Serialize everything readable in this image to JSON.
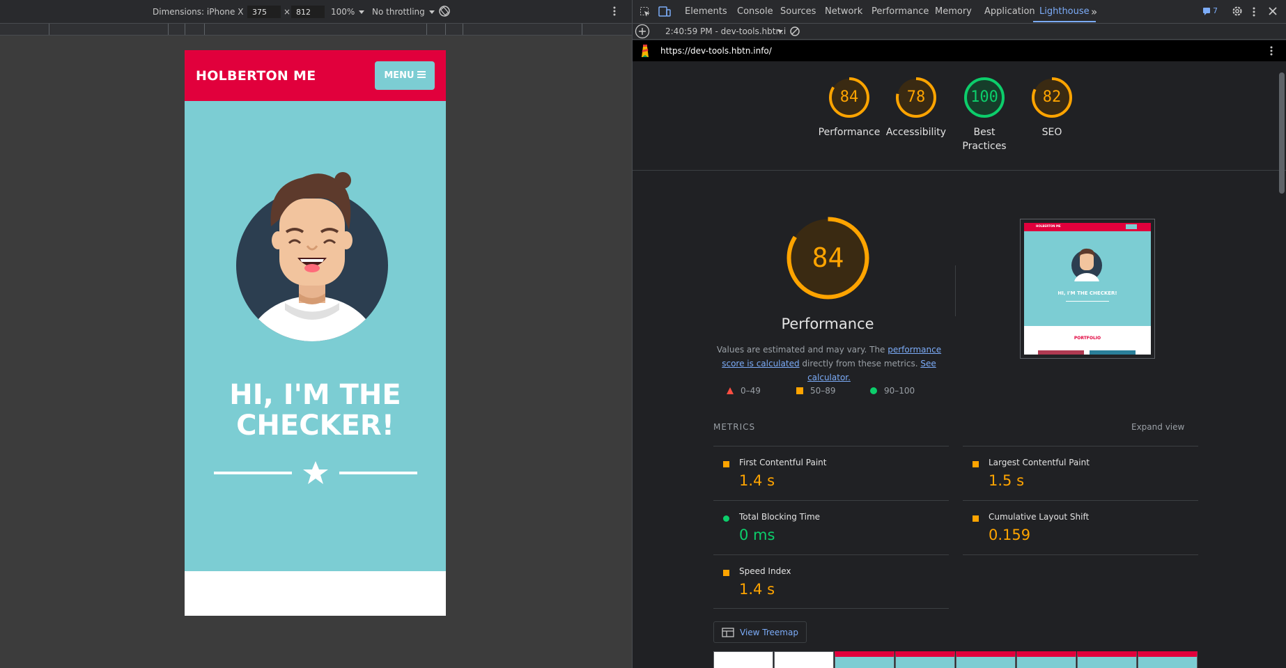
{
  "device_toolbar": {
    "dimensions_label": "Dimensions: iPhone X",
    "width": "375",
    "times": "×",
    "height": "812",
    "zoom": "100%",
    "throttling": "No throttling"
  },
  "phone": {
    "brand": "HOLBERTON ME",
    "menu_label": "MENU",
    "hero_title_line1": "HI, I'M THE",
    "hero_title_line2": "CHECKER!",
    "colors": {
      "header": "#e1003c",
      "hero": "#7ccdd3"
    }
  },
  "devtools": {
    "tabs": [
      "Elements",
      "Console",
      "Sources",
      "Network",
      "Performance",
      "Memory",
      "Application",
      "Lighthouse"
    ],
    "active_tab": "Lighthouse",
    "issues_count": "7",
    "report_time": "2:40:59 PM - dev-tools.hbtn.i",
    "url": "https://dev-tools.hbtn.info/"
  },
  "scores": [
    {
      "value": 84,
      "label": "Performance",
      "color": "#ffa400"
    },
    {
      "value": 78,
      "label": "Accessibility",
      "color": "#ffa400"
    },
    {
      "value": 100,
      "label_line1": "Best",
      "label_line2": "Practices",
      "color": "#0cce6b"
    },
    {
      "value": 82,
      "label": "SEO",
      "color": "#ffa400"
    }
  ],
  "performance": {
    "score": "84",
    "title": "Performance",
    "desc_prefix": "Values are estimated and may vary. The ",
    "desc_link1": "performance score is calculated",
    "desc_middle": " directly from these metrics. ",
    "desc_link2": "See calculator.",
    "legend": [
      {
        "range": "0–49",
        "shape": "triangle",
        "color": "#ff4e42"
      },
      {
        "range": "50–89",
        "shape": "square",
        "color": "#ffa400"
      },
      {
        "range": "90–100",
        "shape": "circle",
        "color": "#0cce6b"
      }
    ]
  },
  "metrics": {
    "title": "METRICS",
    "expand": "Expand view",
    "items": [
      {
        "name": "First Contentful Paint",
        "value": "1.4 s",
        "status": "average"
      },
      {
        "name": "Largest Contentful Paint",
        "value": "1.5 s",
        "status": "average"
      },
      {
        "name": "Total Blocking Time",
        "value": "0 ms",
        "status": "pass"
      },
      {
        "name": "Cumulative Layout Shift",
        "value": "0.159",
        "status": "average"
      },
      {
        "name": "Speed Index",
        "value": "1.4 s",
        "status": "average"
      }
    ]
  },
  "treemap_label": "View Treemap",
  "thumbnail": {
    "brand": "HOLBERTON ME",
    "title": "HI, I'M THE CHECKER!",
    "section": "PORTFOLIO"
  }
}
